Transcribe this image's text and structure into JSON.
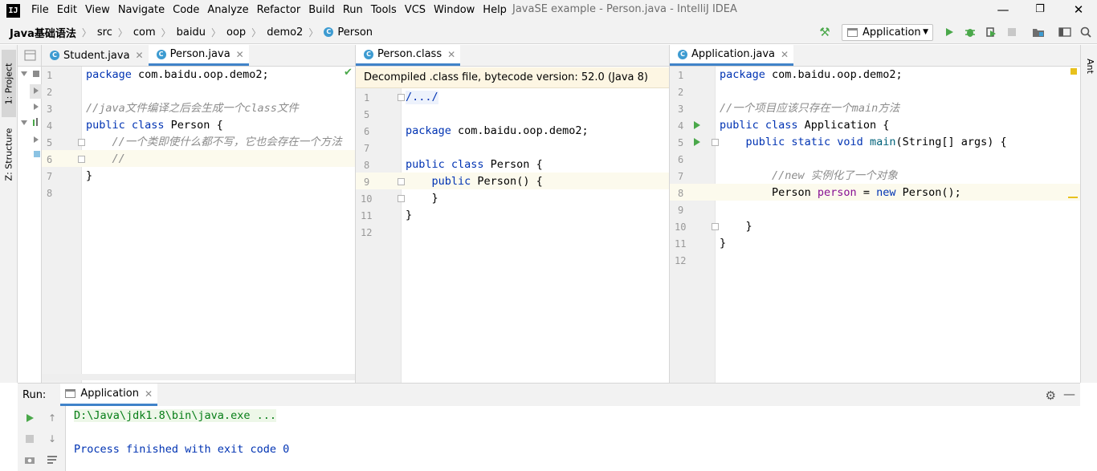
{
  "app": {
    "logo": "IJ",
    "title": "JavaSE example - Person.java - IntelliJ IDEA"
  },
  "menu": [
    "File",
    "Edit",
    "View",
    "Navigate",
    "Code",
    "Analyze",
    "Refactor",
    "Build",
    "Run",
    "Tools",
    "VCS",
    "Window",
    "Help"
  ],
  "window_controls": {
    "minimize": "—",
    "restore": "❐",
    "close": "✕"
  },
  "breadcrumb": [
    "Java基础语法",
    "src",
    "com",
    "baidu",
    "oop",
    "demo2",
    "Person"
  ],
  "run_config": {
    "selected": "Application"
  },
  "toolbar_icons": [
    "build-hammer-icon",
    "run-icon",
    "debug-icon",
    "coverage-icon",
    "stop-icon",
    "project-structure-icon",
    "toggle-layout-icon",
    "search-everywhere-icon"
  ],
  "left_tool_tabs": [
    "1: Project",
    "Z: Structure"
  ],
  "right_tool_tabs": [
    "Ant"
  ],
  "colors": {
    "keyword": "#0033b3",
    "comment": "#8c8c8c",
    "string": "#067d17",
    "accent": "#4083c9",
    "run_green": "#4aa84a"
  },
  "panes": {
    "left": {
      "tabs": [
        {
          "label": "Student.java",
          "active": false
        },
        {
          "label": "Person.java",
          "active": true
        }
      ],
      "lines": [
        "package com.baidu.oop.demo2;",
        "",
        "//java文件编译之后会生成一个class文件",
        "public class Person {",
        "    //一个类即使什么都不写，它也会存在一个方法",
        "    //",
        "}",
        ""
      ]
    },
    "middle": {
      "tabs": [
        {
          "label": "Person.class",
          "active": true
        }
      ],
      "banner": "Decompiled .class file, bytecode version: 52.0 (Java 8)",
      "line_numbers": [
        "1",
        "5",
        "6",
        "7",
        "8",
        "9",
        "10",
        "11",
        "12"
      ],
      "lines": [
        "/.../",
        "",
        "package com.baidu.oop.demo2;",
        "",
        "public class Person {",
        "    public Person() {",
        "    }",
        "}",
        ""
      ]
    },
    "right": {
      "tabs": [
        {
          "label": "Application.java",
          "active": true
        }
      ],
      "lines": [
        "package com.baidu.oop.demo2;",
        "",
        "//一个项目应该只存在一个main方法",
        "public class Application {",
        "    public static void main(String[] args) {",
        "",
        "        //new 实例化了一个对象",
        "        Person person = new Person();",
        "",
        "    }",
        "}",
        ""
      ]
    }
  },
  "run_window": {
    "title": "Run:",
    "tab": "Application",
    "console": [
      "D:\\Java\\jdk1.8\\bin\\java.exe ...",
      "",
      "Process finished with exit code 0"
    ]
  }
}
